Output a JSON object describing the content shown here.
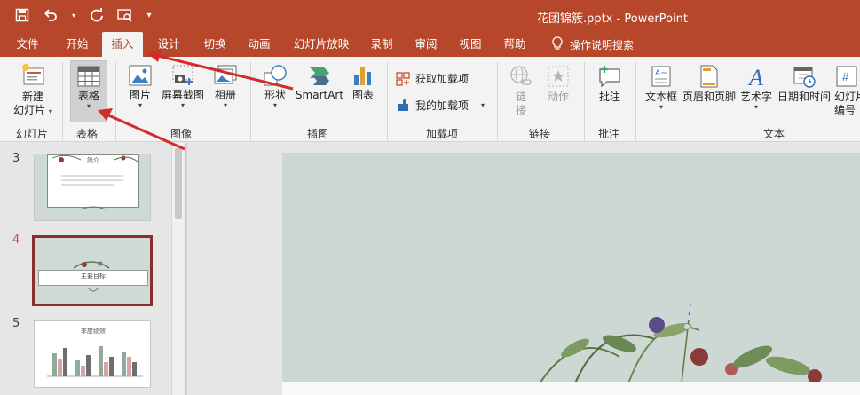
{
  "window": {
    "title": "花团锦簇.pptx  -  PowerPoint"
  },
  "qat": {
    "items": [
      "save-icon",
      "undo-icon",
      "redo-icon",
      "present-icon",
      "customize-icon"
    ]
  },
  "tabs": [
    "文件",
    "开始",
    "插入",
    "设计",
    "切换",
    "动画",
    "幻灯片放映",
    "录制",
    "审阅",
    "视图",
    "帮助"
  ],
  "active_tab": "插入",
  "tell_me": {
    "label": "操作说明搜索"
  },
  "ribbon": {
    "groups": {
      "slides": "幻灯片",
      "tables": "表格",
      "images": "图像",
      "illustrations": "插图",
      "addins": "加载项",
      "links": "链接",
      "comments": "批注",
      "text": "文本"
    },
    "buttons": {
      "new_slide_line1": "新建",
      "new_slide_line2": "幻灯片",
      "table": "表格",
      "pictures": "图片",
      "screenshot": "屏幕截图",
      "album": "相册",
      "shapes": "形状",
      "smartart": "SmartArt",
      "chart": "图表",
      "get_addins": "获取加载项",
      "my_addins": "我的加载项",
      "link_line1": "链",
      "link_line2": "接",
      "action": "动作",
      "comment": "批注",
      "textbox": "文本框",
      "header_footer": "页眉和页脚",
      "wordart": "艺术字",
      "datetime": "日期和时间",
      "slidenum_line1": "幻灯片",
      "slidenum_line2": "编号"
    }
  },
  "slides": [
    {
      "number": "3",
      "title": "简介"
    },
    {
      "number": "4",
      "title": "主要目标",
      "selected": true
    },
    {
      "number": "5",
      "title": "季度绩效"
    }
  ],
  "colors": {
    "accent": "#b7472a",
    "selected_thumb": "#8b2e2e",
    "slide_bg": "#cdd8d4"
  }
}
